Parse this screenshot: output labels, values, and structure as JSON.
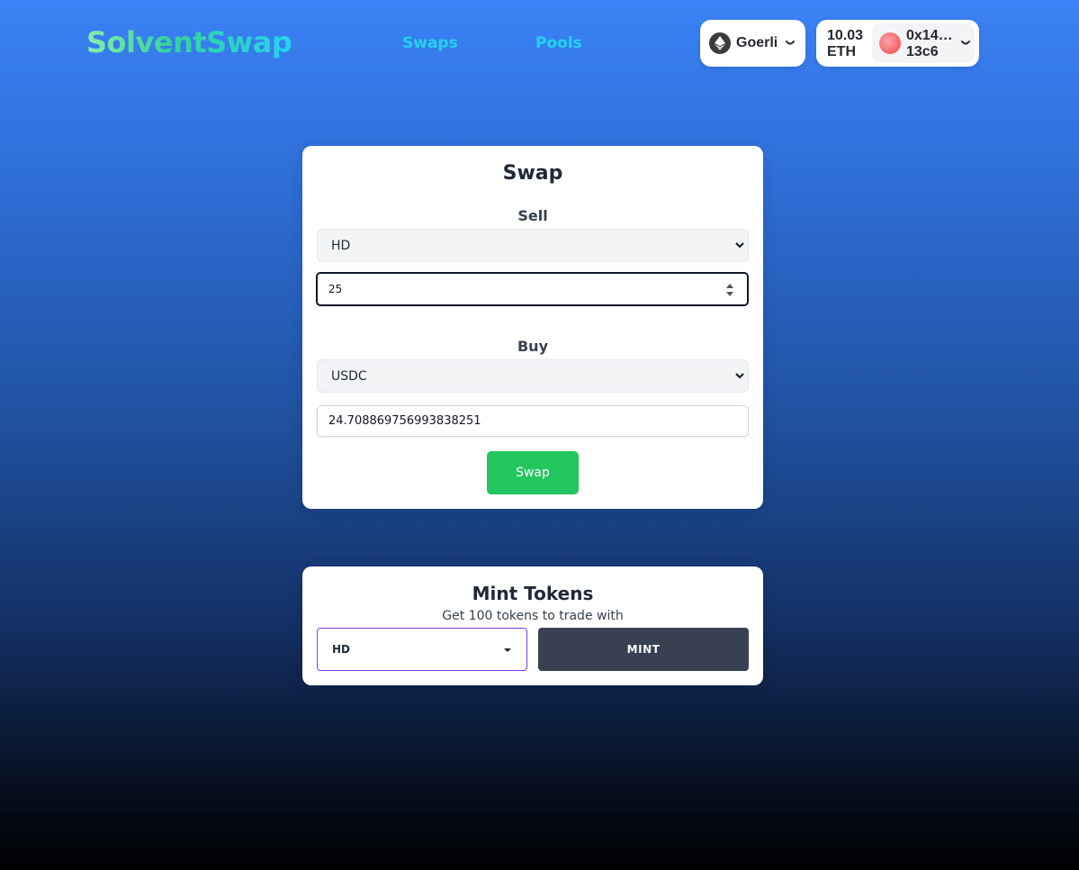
{
  "nav": {
    "brand": "SolventSwap",
    "links": [
      "Swaps",
      "Pools"
    ],
    "chain": {
      "name": "Goerli",
      "icon": "ethereum-icon"
    },
    "account": {
      "balance_line1": "10.03",
      "balance_line2": "ETH",
      "address_line1": "0x14…",
      "address_line2": "13c6"
    }
  },
  "swap": {
    "title": "Swap",
    "sell_label": "Sell",
    "sell_token": "HD",
    "sell_amount": "25",
    "buy_label": "Buy",
    "buy_token": "USDC",
    "buy_amount": "24.708869756993838251",
    "button": "Swap"
  },
  "mint": {
    "title": "Mint Tokens",
    "subtitle": "Get 100 tokens to trade with",
    "token": "HD",
    "button": "MINT"
  },
  "colors": {
    "brand_gradient_start": "#86efac",
    "brand_gradient_end": "#22d3ee",
    "nav_link": "#22d3ee",
    "swap_button": "#22c55e",
    "mint_button": "#374151",
    "mint_select_border": "#7c3aed"
  }
}
